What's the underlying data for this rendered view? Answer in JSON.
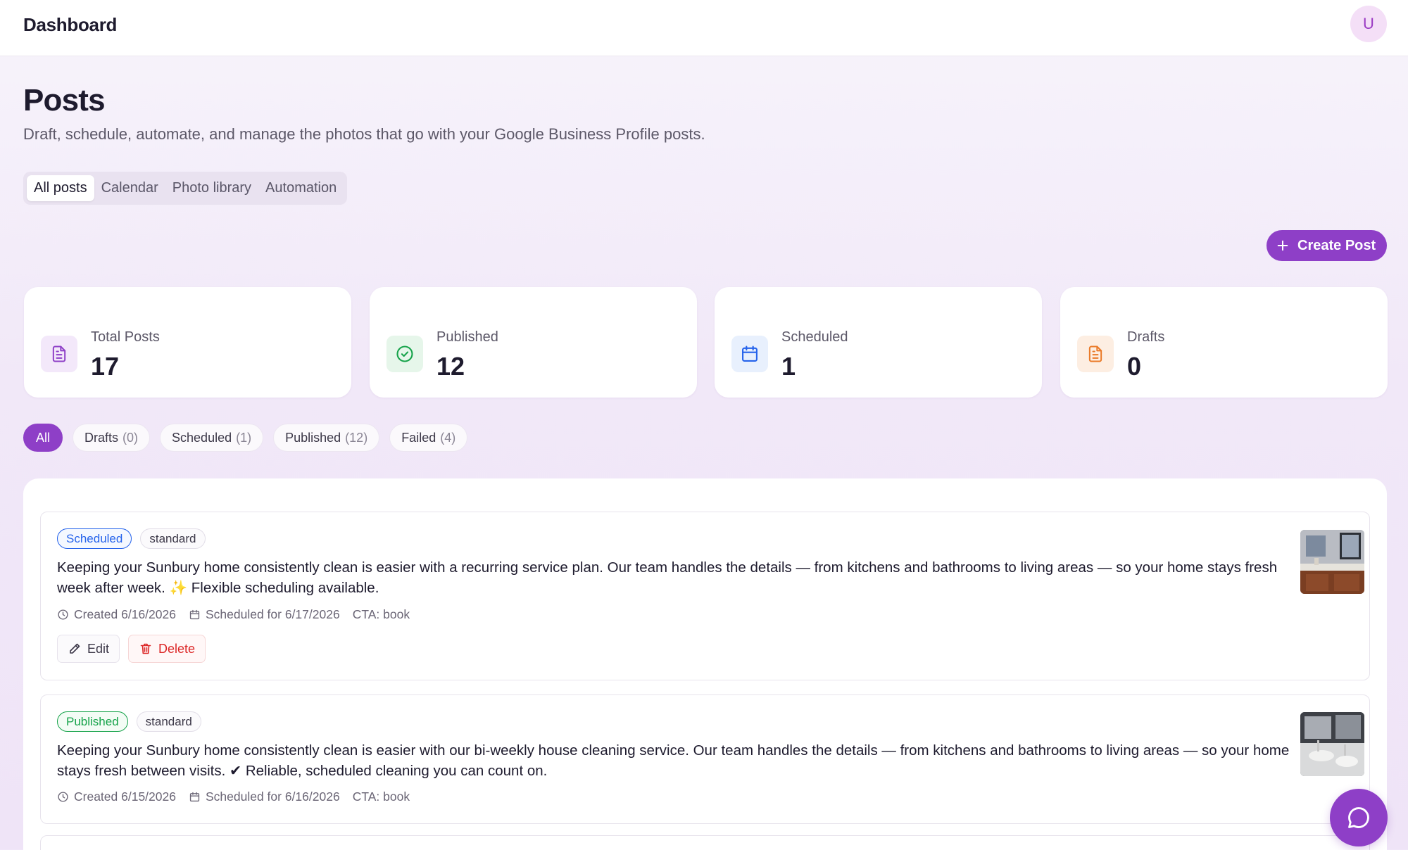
{
  "header": {
    "brand": "Dashboard",
    "avatar_initial": "U"
  },
  "page": {
    "title": "Posts",
    "subtitle": "Draft, schedule, automate, and manage the photos that go with your Google Business Profile posts."
  },
  "tabs": [
    {
      "label": "All posts",
      "active": true
    },
    {
      "label": "Calendar",
      "active": false
    },
    {
      "label": "Photo library",
      "active": false
    },
    {
      "label": "Automation",
      "active": false
    }
  ],
  "create_button": {
    "label": "Create Post",
    "icon": "plus-icon"
  },
  "stats": [
    {
      "label": "Total Posts",
      "value": "17",
      "icon": "document-icon",
      "color": "#8e3fc7",
      "bg": "#f3e8fa"
    },
    {
      "label": "Published",
      "value": "12",
      "icon": "check-circle-icon",
      "color": "#16a34a",
      "bg": "#e6f6ea"
    },
    {
      "label": "Scheduled",
      "value": "1",
      "icon": "calendar-icon",
      "color": "#2563eb",
      "bg": "#e8f0fd"
    },
    {
      "label": "Drafts",
      "value": "0",
      "icon": "document-icon",
      "color": "#ea7a28",
      "bg": "#fdeee2"
    }
  ],
  "filters": [
    {
      "label": "All",
      "count": "",
      "active": true
    },
    {
      "label": "Drafts",
      "count": "(0)",
      "active": false
    },
    {
      "label": "Scheduled",
      "count": "(1)",
      "active": false
    },
    {
      "label": "Published",
      "count": "(12)",
      "active": false
    },
    {
      "label": "Failed",
      "count": "(4)",
      "active": false
    }
  ],
  "posts": [
    {
      "status": "Scheduled",
      "type": "standard",
      "text": "Keeping your Sunbury home consistently clean is easier with a recurring service plan. Our team handles the details — from kitchens and bathrooms to living areas — so your home stays fresh week after week. ✨ Flexible scheduling available.",
      "created": "Created 6/16/2026",
      "scheduled": "Scheduled for 6/17/2026",
      "cta": "CTA: book",
      "edit_label": "Edit",
      "delete_label": "Delete"
    },
    {
      "status": "Published",
      "type": "standard",
      "text": "Keeping your Sunbury home consistently clean is easier with our bi-weekly house cleaning service. Our team handles the details — from kitchens and bathrooms to living areas — so your home stays fresh between visits. ✔ Reliable, scheduled cleaning you can count on.",
      "created": "Created 6/15/2026",
      "scheduled": "Scheduled for 6/16/2026",
      "cta": "CTA: book"
    }
  ],
  "chat": {
    "icon": "chat-bubble-icon"
  },
  "colors": {
    "accent": "#8e3fc7",
    "scheduled": "#2563eb",
    "published": "#16a34a",
    "danger": "#dc2626"
  }
}
